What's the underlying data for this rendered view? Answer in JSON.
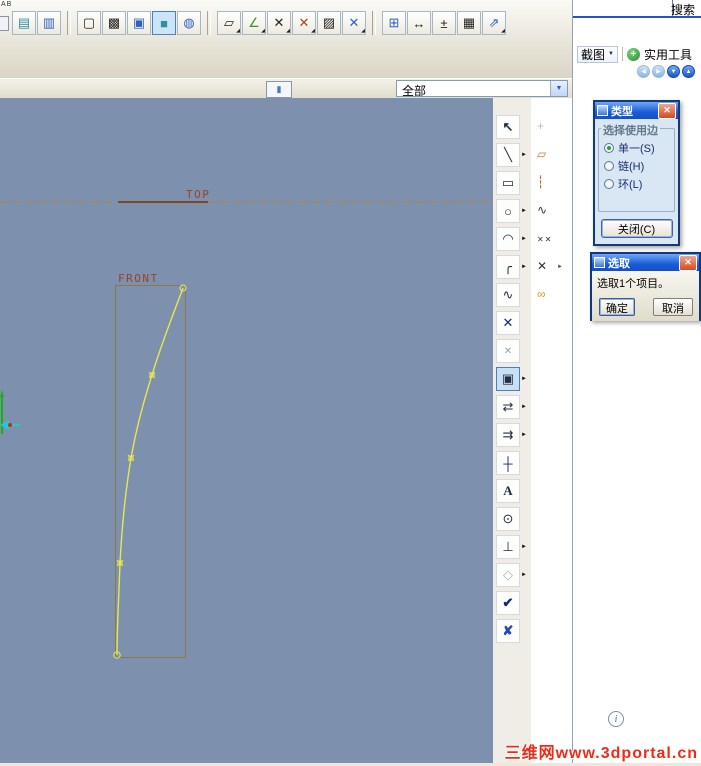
{
  "app": {
    "search_label": "搜索",
    "watermark": "三维网www.3dportal.cn",
    "info_glyph": "i"
  },
  "icons": {
    "flyout": "►",
    "corner": "◢",
    "combo_arrow": "▼",
    "menu_arrow": "▼",
    "plus": "+",
    "close": "✕",
    "status_bar": "▮",
    "nav_back": "◀",
    "nav_forward": "▶",
    "nav_down": "▼",
    "nav_up": "▲"
  },
  "quick_tools": {
    "screenshot_label": "截图",
    "utility_label": "实用工具"
  },
  "filter_bar": {
    "combo_value": "全部"
  },
  "toolbar_top": {
    "fragment": "AB",
    "buttons": {
      "layer_stack": "▤",
      "layer_note": "▥",
      "box_wire": "▢",
      "box_hidden": "▩",
      "box_nohid": "▣",
      "box_shaded": "■",
      "sphere": "◍",
      "parallelogram": "▱",
      "angle_line": "∠",
      "points_a": "✕",
      "points_b": "✕",
      "hatch": "▨",
      "points_c": "✕",
      "select_box": "⊞",
      "dim_h": "↔",
      "plus_minus": "±",
      "grid": "▦",
      "snap_line": "⇗"
    }
  },
  "sketch_tools": {
    "rows": [
      {
        "main": {
          "name": "select",
          "icon": "↖"
        },
        "secondary": {
          "name": "dim-reference",
          "icon": "+"
        }
      },
      {
        "main": {
          "name": "line",
          "icon": "╲"
        },
        "secondary": {
          "name": "parallelogram",
          "icon": "▱"
        }
      },
      {
        "main": {
          "name": "rectangle",
          "icon": "▭"
        },
        "secondary": {
          "name": "centerline",
          "icon": "┆"
        }
      },
      {
        "main": {
          "name": "circle",
          "icon": "○"
        },
        "secondary": {
          "name": "conic",
          "icon": "∿"
        }
      },
      {
        "main": {
          "name": "arc",
          "icon": "◠"
        },
        "secondary": {
          "name": "points-pair",
          "icon": "✕✕"
        }
      },
      {
        "main": {
          "name": "fillet",
          "icon": "╭"
        },
        "secondary": {
          "name": "point-arrow",
          "icon": "✕"
        }
      },
      {
        "main": {
          "name": "spline",
          "icon": "∿"
        },
        "secondary": {
          "name": "chain",
          "icon": "∞"
        }
      },
      {
        "main": {
          "name": "point",
          "icon": "✕"
        }
      },
      {
        "main": {
          "name": "coordinate-system",
          "icon": "✕"
        }
      },
      {
        "main": {
          "name": "use-edge",
          "icon": "▣"
        }
      },
      {
        "main": {
          "name": "offset-edge",
          "icon": "⇄"
        }
      },
      {
        "main": {
          "name": "thicken-edge",
          "icon": "⇉"
        }
      },
      {
        "main": {
          "name": "dimension",
          "icon": "┼"
        }
      },
      {
        "main": {
          "name": "text",
          "icon": "A"
        }
      },
      {
        "main": {
          "name": "palette",
          "icon": "⊙"
        }
      },
      {
        "main": {
          "name": "constraint",
          "icon": "⊥"
        }
      },
      {
        "main": {
          "name": "mirror",
          "icon": "◇"
        }
      },
      {
        "main": {
          "name": "done",
          "icon": "✔"
        }
      },
      {
        "main": {
          "name": "cancel",
          "icon": "✘"
        }
      }
    ]
  },
  "canvas": {
    "top_plane_label": "TOP",
    "front_plane_label": "FRONT"
  },
  "type_dialog": {
    "title": "类型",
    "group_label": "选择使用边",
    "options": [
      {
        "label": "单一(S)",
        "selected": true
      },
      {
        "label": "链(H)",
        "selected": false
      },
      {
        "label": "环(L)",
        "selected": false
      }
    ],
    "close_label": "关闭(C)"
  },
  "select_dialog": {
    "title": "选取",
    "message": "选取1个项目。",
    "ok_label": "确定",
    "cancel_label": "取消"
  },
  "colors": {
    "canvas_bg": "#7d90ad",
    "spline": "#e9e74f",
    "plane_line": "#b5832f",
    "plane_label": "#97432b",
    "sketch_border": "#8a7a48",
    "titlebar_start": "#6fa8f7",
    "titlebar_end": "#1450c4",
    "close_button": "#d34a21",
    "radio_dot": "#2f9e2f"
  }
}
